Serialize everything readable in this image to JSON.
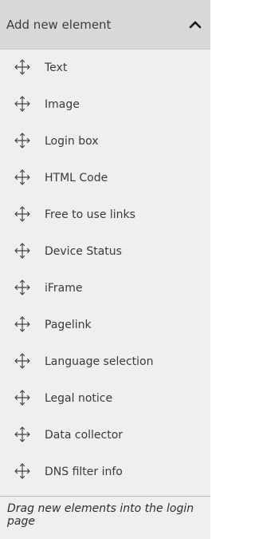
{
  "panel": {
    "title": "Add new element",
    "collapse_icon": "chevron-up-icon",
    "item_icon": "move-arrows-icon",
    "items": [
      {
        "label": "Text"
      },
      {
        "label": "Image"
      },
      {
        "label": "Login box"
      },
      {
        "label": "HTML Code"
      },
      {
        "label": "Free to use links"
      },
      {
        "label": "Device Status"
      },
      {
        "label": "iFrame"
      },
      {
        "label": "Pagelink"
      },
      {
        "label": "Language selection"
      },
      {
        "label": "Legal notice"
      },
      {
        "label": "Data collector"
      },
      {
        "label": "DNS filter info"
      }
    ],
    "footer_hint": "Drag new elements into the login page"
  },
  "colors": {
    "header_bg": "#d8d8d8",
    "panel_bg": "#efefef",
    "text": "#3a3a3a"
  }
}
